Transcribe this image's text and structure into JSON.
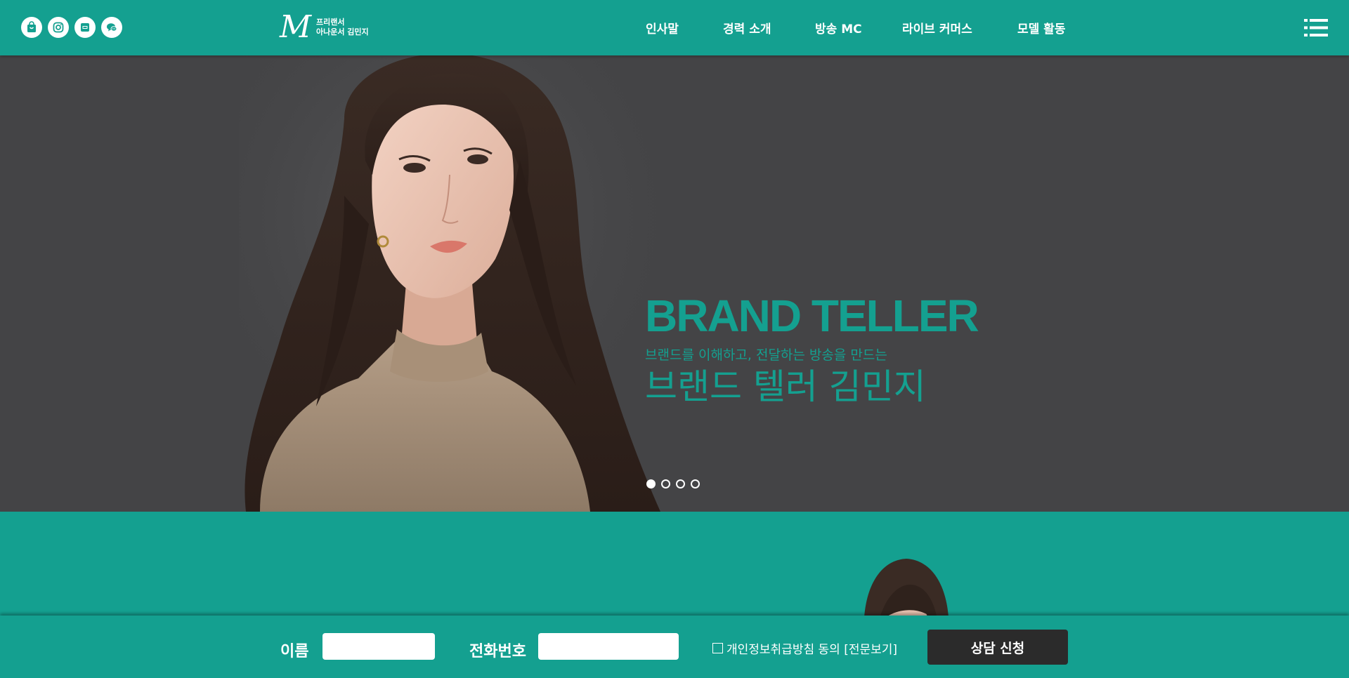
{
  "header": {
    "social_icons": [
      "shopping-bag-icon",
      "instagram-icon",
      "blog-icon",
      "kakao-talk-icon"
    ],
    "logo_mark": "M",
    "logo_line1": "프리랜서",
    "logo_line2": "아나운서 김민지",
    "nav": [
      "인사말",
      "경력 소개",
      "방송 MC",
      "라이브 커머스",
      "모델 활동"
    ],
    "menu_icon": "hamburger-menu-icon"
  },
  "hero": {
    "title": "BRAND TELLER",
    "subtitle": "브랜드를 이해하고, 전달하는 방송을 만드는",
    "name": "브랜드 텔러 김민지",
    "slide_count": 4,
    "active_slide": 1
  },
  "form": {
    "name_label": "이름",
    "name_value": "",
    "phone_label": "전화번호",
    "phone_value": "",
    "consent_text": "개인정보취급방침 동의 [전문보기]",
    "submit_label": "상담 신청"
  },
  "colors": {
    "accent": "#14a090",
    "hero_bg": "#444446",
    "button_bg": "#2b2b2b"
  }
}
